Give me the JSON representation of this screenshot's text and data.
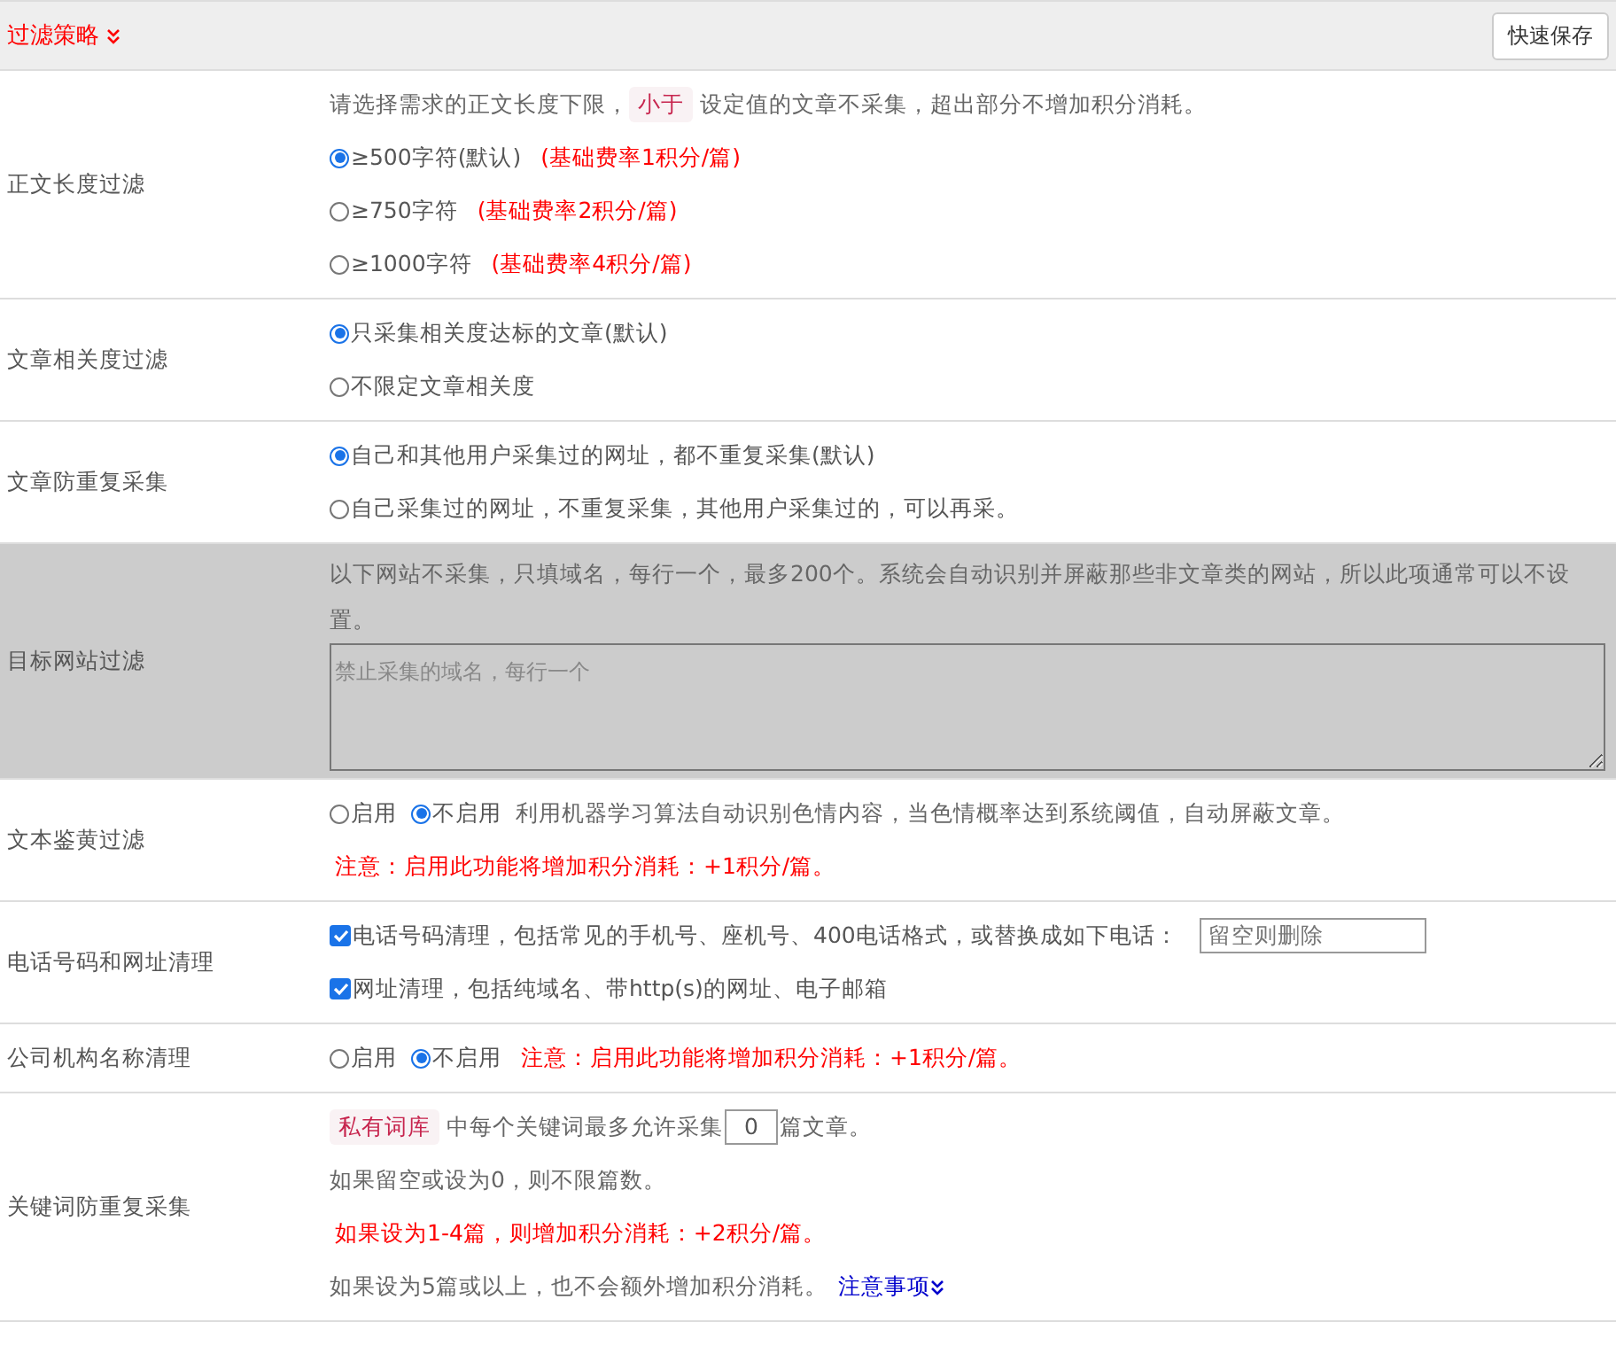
{
  "header": {
    "title": "过滤策略",
    "save_button": "快速保存"
  },
  "rows": [
    {
      "label": "正文长度过滤",
      "shaded": false,
      "lines": [
        [
          {
            "kind": "text",
            "text": "请选择需求的正文长度下限，"
          },
          {
            "kind": "tag",
            "text": "小于"
          },
          {
            "kind": "text",
            "text": "设定值的文章不采集，超出部分不增加积分消耗。"
          }
        ],
        [
          {
            "kind": "radio",
            "text": "≥500字符(默认)",
            "selected": true
          },
          {
            "kind": "warn",
            "text": "(基础费率1积分/篇)"
          }
        ],
        [
          {
            "kind": "radio",
            "text": "≥750字符",
            "selected": false
          },
          {
            "kind": "warn",
            "text": "(基础费率2积分/篇)"
          }
        ],
        [
          {
            "kind": "radio",
            "text": "≥1000字符",
            "selected": false
          },
          {
            "kind": "warn",
            "text": "(基础费率4积分/篇)"
          }
        ]
      ]
    },
    {
      "label": "文章相关度过滤",
      "shaded": false,
      "lines": [
        [
          {
            "kind": "radio",
            "text": "只采集相关度达标的文章(默认)",
            "selected": true
          }
        ],
        [
          {
            "kind": "radio",
            "text": "不限定文章相关度",
            "selected": false
          }
        ]
      ]
    },
    {
      "label": "文章防重复采集",
      "shaded": false,
      "lines": [
        [
          {
            "kind": "radio",
            "text": "自己和其他用户采集过的网址，都不重复采集(默认)",
            "selected": true
          }
        ],
        [
          {
            "kind": "radio",
            "text": "自己采集过的网址，不重复采集，其他用户采集过的，可以再采。",
            "selected": false
          }
        ]
      ]
    },
    {
      "label": "目标网站过滤",
      "shaded": true,
      "lines": [
        [
          {
            "kind": "text",
            "text": "以下网站不采集，只填域名，每行一个，最多200个。系统会自动识别并屏蔽那些非文章类的网站，所以此项通常可以不设置。"
          }
        ],
        [
          {
            "kind": "textarea",
            "placeholder": "禁止采集的域名，每行一个"
          }
        ]
      ]
    },
    {
      "label": "文本鉴黄过滤",
      "shaded": false,
      "lines": [
        [
          {
            "kind": "radio",
            "text": "启用",
            "selected": false
          },
          {
            "kind": "radio",
            "text": "不启用",
            "selected": true
          },
          {
            "kind": "text",
            "text": "利用机器学习算法自动识别色情内容，当色情概率达到系统阈值，自动屏蔽文章。"
          }
        ],
        [
          {
            "kind": "warn",
            "text": "注意：启用此功能将增加积分消耗：+1积分/篇。"
          }
        ]
      ]
    },
    {
      "label": "电话号码和网址清理",
      "shaded": false,
      "lines": [
        [
          {
            "kind": "checkbox",
            "text": "电话号码清理，包括常见的手机号、座机号、400电话格式，或替换成如下电话：",
            "checked": true
          },
          {
            "kind": "input",
            "placeholder": "留空则删除"
          }
        ],
        [
          {
            "kind": "checkbox",
            "text": "网址清理，包括纯域名、带http(s)的网址、电子邮箱",
            "checked": true
          }
        ]
      ]
    },
    {
      "label": "公司机构名称清理",
      "shaded": false,
      "lines": [
        [
          {
            "kind": "radio",
            "text": "启用",
            "selected": false
          },
          {
            "kind": "radio",
            "text": "不启用",
            "selected": true
          },
          {
            "kind": "warn",
            "text": "注意：启用此功能将增加积分消耗：+1积分/篇。"
          }
        ]
      ]
    },
    {
      "label": "关键词防重复采集",
      "shaded": false,
      "lines": [
        [
          {
            "kind": "tag",
            "text": "私有词库"
          },
          {
            "kind": "text",
            "text": "中每个关键词最多允许采集"
          },
          {
            "kind": "number",
            "value": "0"
          },
          {
            "kind": "text",
            "text": "篇文章。"
          }
        ],
        [
          {
            "kind": "text",
            "text": "如果留空或设为0，则不限篇数。"
          }
        ],
        [
          {
            "kind": "warn",
            "text": "如果设为1-4篇，则增加积分消耗：+2积分/篇。"
          }
        ],
        [
          {
            "kind": "text",
            "text": "如果设为5篇或以上，也不会额外增加积分消耗。"
          },
          {
            "kind": "link",
            "text": "注意事项"
          }
        ]
      ]
    }
  ]
}
